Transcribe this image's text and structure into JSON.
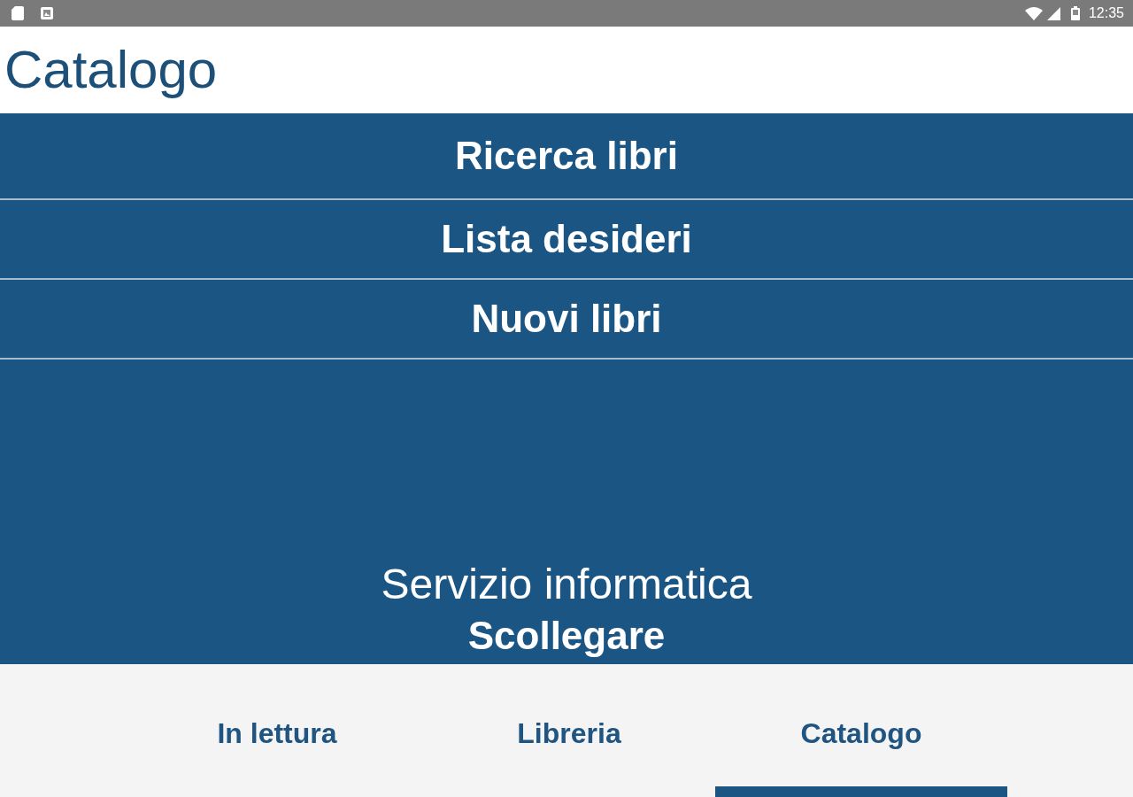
{
  "status_bar": {
    "time": "12:35"
  },
  "app_bar": {
    "title": "Catalogo"
  },
  "menu": [
    {
      "label": "Ricerca libri"
    },
    {
      "label": "Lista desideri"
    },
    {
      "label": "Nuovi libri"
    }
  ],
  "account": {
    "user": "Servizio informatica",
    "logout": "Scollegare"
  },
  "tabs": [
    {
      "label": "In lettura",
      "selected": false
    },
    {
      "label": "Libreria",
      "selected": false
    },
    {
      "label": "Catalogo",
      "selected": true
    }
  ]
}
